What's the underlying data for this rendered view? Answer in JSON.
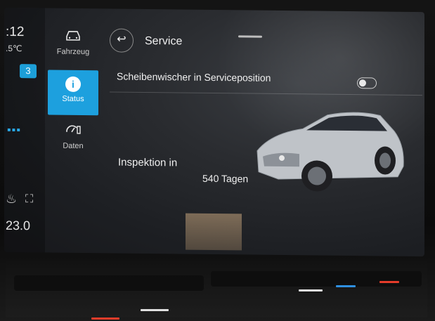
{
  "status_bar": {
    "time": ":12",
    "outside_temp": ".5℃",
    "badge": "3",
    "cabin_temp": "23.0"
  },
  "nav": {
    "items": [
      {
        "label": "Fahrzeug",
        "icon": "car-icon"
      },
      {
        "label": "Status",
        "icon": "info-icon",
        "active": true
      },
      {
        "label": "Daten",
        "icon": "data-gauge-icon"
      }
    ]
  },
  "header": {
    "title": "Service",
    "back_icon": "back-arrow-icon"
  },
  "wiper_setting": {
    "label": "Scheibenwischer in Serviceposition",
    "enabled": false
  },
  "inspection": {
    "label": "Inspektion in",
    "value": "540 Tagen"
  },
  "colors": {
    "accent": "#1da0de",
    "background": "#1d1f23",
    "text": "#f0f0f0"
  }
}
